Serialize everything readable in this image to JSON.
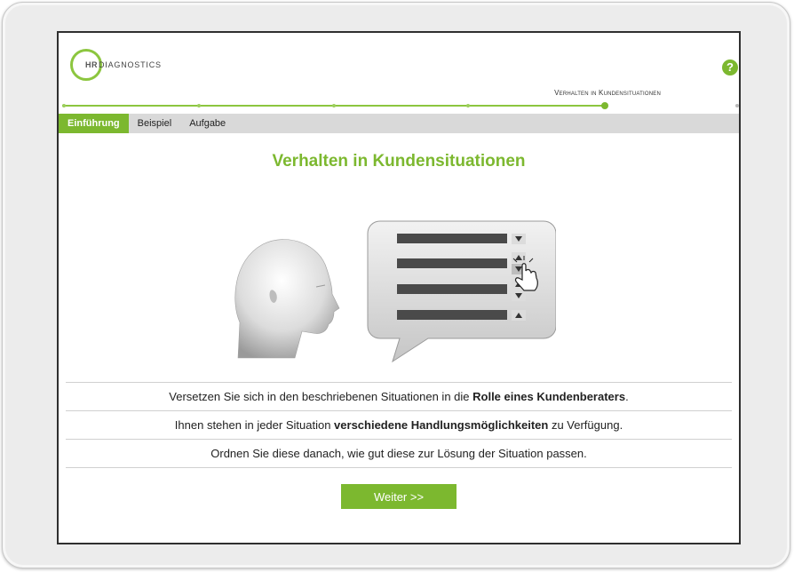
{
  "logo": {
    "mark": "HR",
    "text": "DIAGNOSTICS"
  },
  "help": {
    "symbol": "?"
  },
  "progress": {
    "current_step_label": "Verhalten in Kundensituationen"
  },
  "tabs": [
    {
      "label": "Einführung",
      "active": true
    },
    {
      "label": "Beispiel",
      "active": false
    },
    {
      "label": "Aufgabe",
      "active": false
    }
  ],
  "main": {
    "title": "Verhalten in Kundensituationen",
    "lines": [
      {
        "before": "Versetzen Sie sich in den beschriebenen Situationen in die ",
        "bold": "Rolle eines Kundenberaters",
        "after": "."
      },
      {
        "before": "Ihnen stehen in jeder Situation ",
        "bold": "verschiedene Handlungsmöglichkeiten",
        "after": " zu Verfügung."
      },
      {
        "before": "Ordnen Sie diese danach, wie gut diese zur Lösung der Situation passen.",
        "bold": "",
        "after": ""
      }
    ],
    "next_label": "Weiter >>"
  },
  "colors": {
    "accent": "#7cb82f",
    "tab_bar": "#d9d9d9",
    "frame": "#2f2f2f"
  },
  "icons": [
    "help-icon",
    "head-illustration",
    "speech-bubble-ranking",
    "hand-pointer-icon",
    "arrow-up-icon",
    "arrow-down-icon"
  ]
}
